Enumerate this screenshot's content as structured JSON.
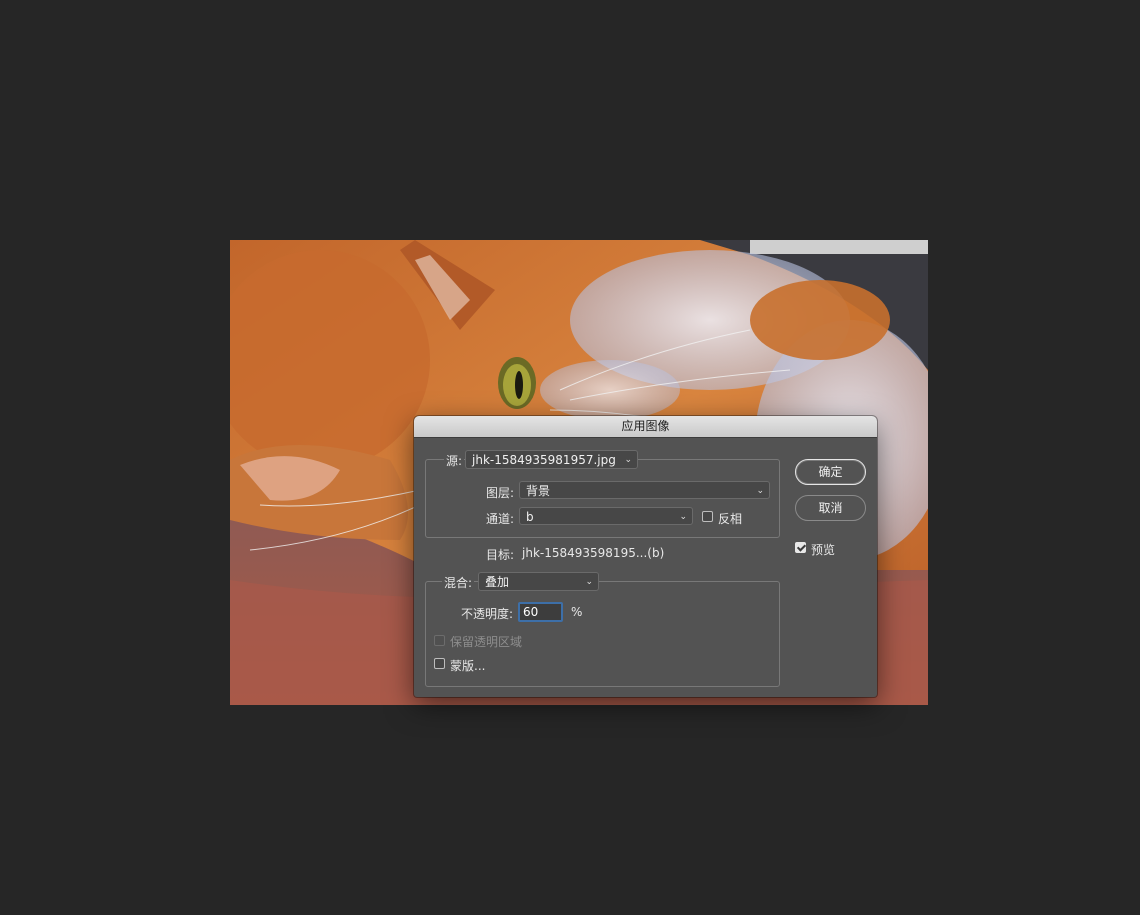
{
  "dialog": {
    "title": "应用图像",
    "source": {
      "label": "源:",
      "value": "jhk-1584935981957.jpg"
    },
    "layer": {
      "label": "图层:",
      "value": "背景"
    },
    "channel": {
      "label": "通道:",
      "value": "b",
      "invert_label": "反相",
      "invert_checked": false
    },
    "target": {
      "label": "目标:",
      "value": "jhk-158493598195...(b)"
    },
    "blending": {
      "label": "混合:",
      "mode": "叠加",
      "opacity_label": "不透明度:",
      "opacity_value": "60",
      "opacity_unit": "%",
      "preserve_transparency_label": "保留透明区域",
      "mask_label": "蒙版..."
    },
    "buttons": {
      "ok": "确定",
      "cancel": "取消"
    },
    "preview": {
      "label": "预览",
      "checked": true
    }
  },
  "colors": {
    "background": "#262626",
    "dialog": "#535353",
    "focus": "#3d6fa8"
  },
  "icons": [
    "chevron-down-icon",
    "checkbox-icon"
  ]
}
